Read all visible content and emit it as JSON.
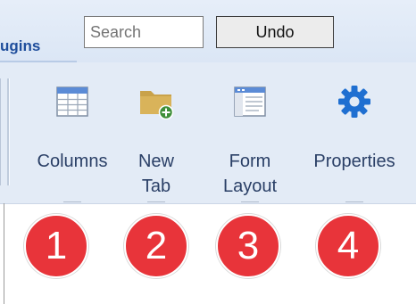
{
  "tab": {
    "label": "ugins"
  },
  "search": {
    "placeholder": "Search",
    "value": ""
  },
  "toolbar": {
    "undo_label": "Undo"
  },
  "ribbon": {
    "buttons": [
      {
        "id": "columns",
        "label": "Columns",
        "icon": "table-grid-icon"
      },
      {
        "id": "new-tab",
        "label": "New\nTab",
        "icon": "folder-add-icon"
      },
      {
        "id": "form-layout",
        "label": "Form\nLayout",
        "icon": "form-layout-icon"
      },
      {
        "id": "properties",
        "label": "Properties",
        "icon": "gear-icon"
      }
    ]
  },
  "callouts": [
    "1",
    "2",
    "3",
    "4"
  ],
  "colors": {
    "accent_blue": "#1f6fd1",
    "badge_red": "#e8343a",
    "ribbon_bg": "#e3ebf6"
  }
}
